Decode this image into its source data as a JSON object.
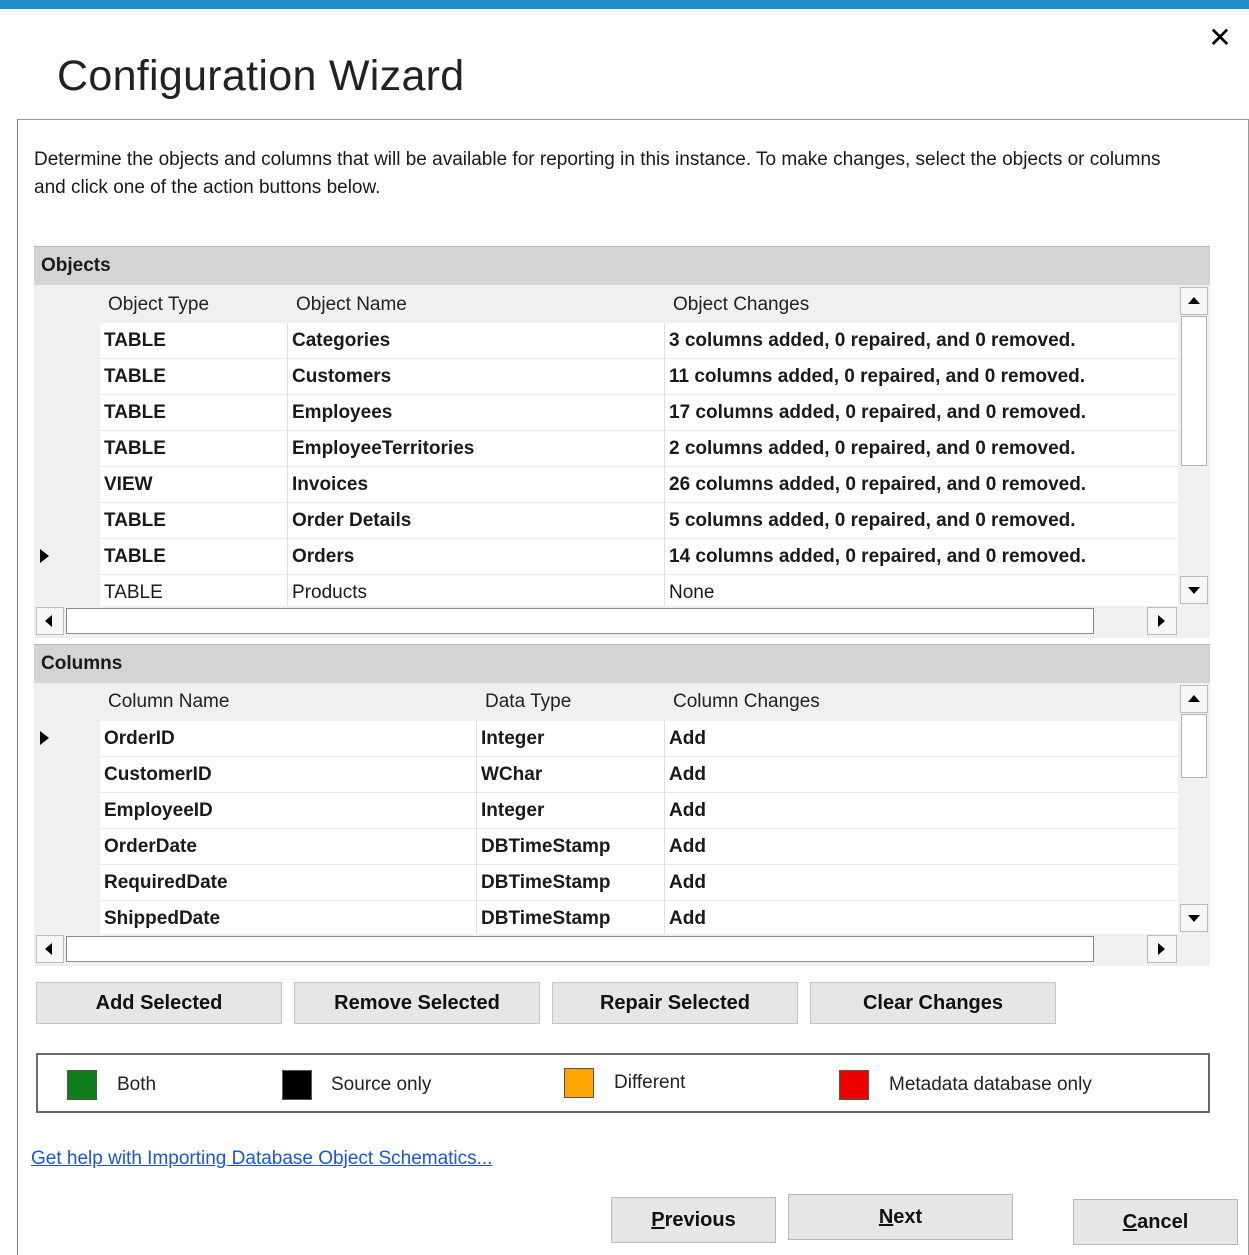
{
  "window": {
    "title": "Configuration Wizard",
    "close_glyph": "✕",
    "description": "Determine the objects and columns that will be available for reporting in this instance. To make changes, select the objects or columns and click one of the action buttons below."
  },
  "objects": {
    "group_label": "Objects",
    "headers": [
      "Object Type",
      "Object Name",
      "Object Changes"
    ],
    "current_row_index": 6,
    "rows": [
      {
        "type": "TABLE",
        "name": "Categories",
        "changes": "3 columns added, 0 repaired, and 0 removed.",
        "bold": true
      },
      {
        "type": "TABLE",
        "name": "Customers",
        "changes": "11 columns added, 0 repaired, and 0 removed.",
        "bold": true
      },
      {
        "type": "TABLE",
        "name": "Employees",
        "changes": "17 columns added, 0 repaired, and 0 removed.",
        "bold": true
      },
      {
        "type": "TABLE",
        "name": "EmployeeTerritories",
        "changes": "2 columns added, 0 repaired, and 0 removed.",
        "bold": true
      },
      {
        "type": "VIEW",
        "name": "Invoices",
        "changes": "26 columns added, 0 repaired, and 0 removed.",
        "bold": true
      },
      {
        "type": "TABLE",
        "name": "Order Details",
        "changes": "5 columns added, 0 repaired, and 0 removed.",
        "bold": true
      },
      {
        "type": "TABLE",
        "name": "Orders",
        "changes": "14 columns added, 0 repaired, and 0 removed.",
        "bold": true
      },
      {
        "type": "TABLE",
        "name": "Products",
        "changes": "None",
        "bold": false
      }
    ]
  },
  "columns": {
    "group_label": "Columns",
    "headers": [
      "Column Name",
      "Data Type",
      "Column Changes"
    ],
    "current_row_index": 0,
    "rows": [
      {
        "name": "OrderID",
        "type": "Integer",
        "change": "Add"
      },
      {
        "name": "CustomerID",
        "type": "WChar",
        "change": "Add"
      },
      {
        "name": "EmployeeID",
        "type": "Integer",
        "change": "Add"
      },
      {
        "name": "OrderDate",
        "type": "DBTimeStamp",
        "change": "Add"
      },
      {
        "name": "RequiredDate",
        "type": "DBTimeStamp",
        "change": "Add"
      },
      {
        "name": "ShippedDate",
        "type": "DBTimeStamp",
        "change": "Add"
      }
    ]
  },
  "actions": {
    "add_selected": "Add Selected",
    "remove_selected": "Remove Selected",
    "repair_selected": "Repair Selected",
    "clear_changes": "Clear Changes"
  },
  "legend": [
    {
      "label": "Both",
      "color": "#0e7d1a"
    },
    {
      "label": "Source only",
      "color": "#000000"
    },
    {
      "label": "Different",
      "color": "#ffa500"
    },
    {
      "label": "Metadata database only",
      "color": "#ee0000"
    }
  ],
  "help_link": "Get help with Importing Database Object Schematics...",
  "nav": {
    "previous": "Previous",
    "next": "Next",
    "cancel": "Cancel"
  }
}
